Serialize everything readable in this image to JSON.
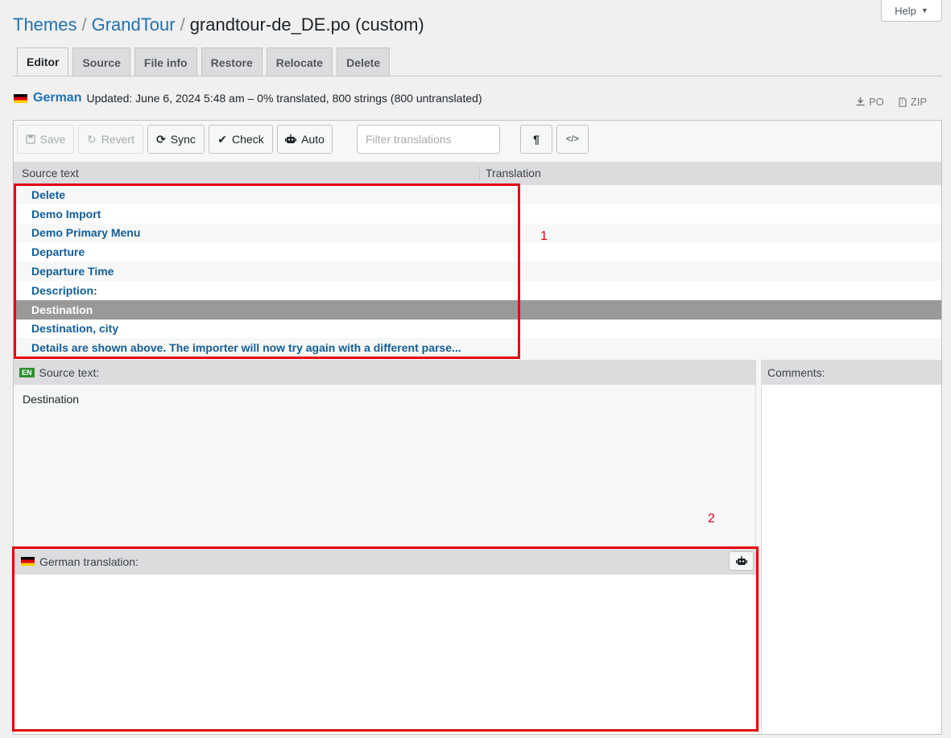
{
  "header": {
    "help_label": "Help",
    "crumb_themes": "Themes",
    "crumb_theme": "GrandTour",
    "sep": "/",
    "file_title": "grandtour-de_DE.po (custom)"
  },
  "tabs": [
    {
      "label": "Editor",
      "active": true
    },
    {
      "label": "Source"
    },
    {
      "label": "File info"
    },
    {
      "label": "Restore"
    },
    {
      "label": "Relocate"
    },
    {
      "label": "Delete"
    }
  ],
  "info": {
    "language": "German",
    "status": "Updated: June 6, 2024 5:48 am – 0% translated, 800 strings (800 untranslated)",
    "download_po": "PO",
    "download_zip": "ZIP"
  },
  "toolbar": {
    "save": "Save",
    "revert": "Revert",
    "sync": "Sync",
    "check": "Check",
    "auto": "Auto",
    "filter_placeholder": "Filter translations"
  },
  "list": {
    "col_source": "Source text",
    "col_translation": "Translation",
    "rows": [
      "Delete",
      "Demo Import",
      "Demo Primary Menu",
      "Departure",
      "Departure Time",
      "Description:",
      "Destination",
      "Destination, city",
      "Details are shown above. The importer will now try again with a different parse..."
    ],
    "selected_index": 6
  },
  "source_pane": {
    "badge": "EN",
    "title": "Source text:",
    "text": "Destination"
  },
  "comments_pane": {
    "title": "Comments:"
  },
  "translation_pane": {
    "title": "German translation:"
  },
  "annotations": {
    "label_1": "1",
    "label_2": "2",
    "color": "#e3000f"
  }
}
